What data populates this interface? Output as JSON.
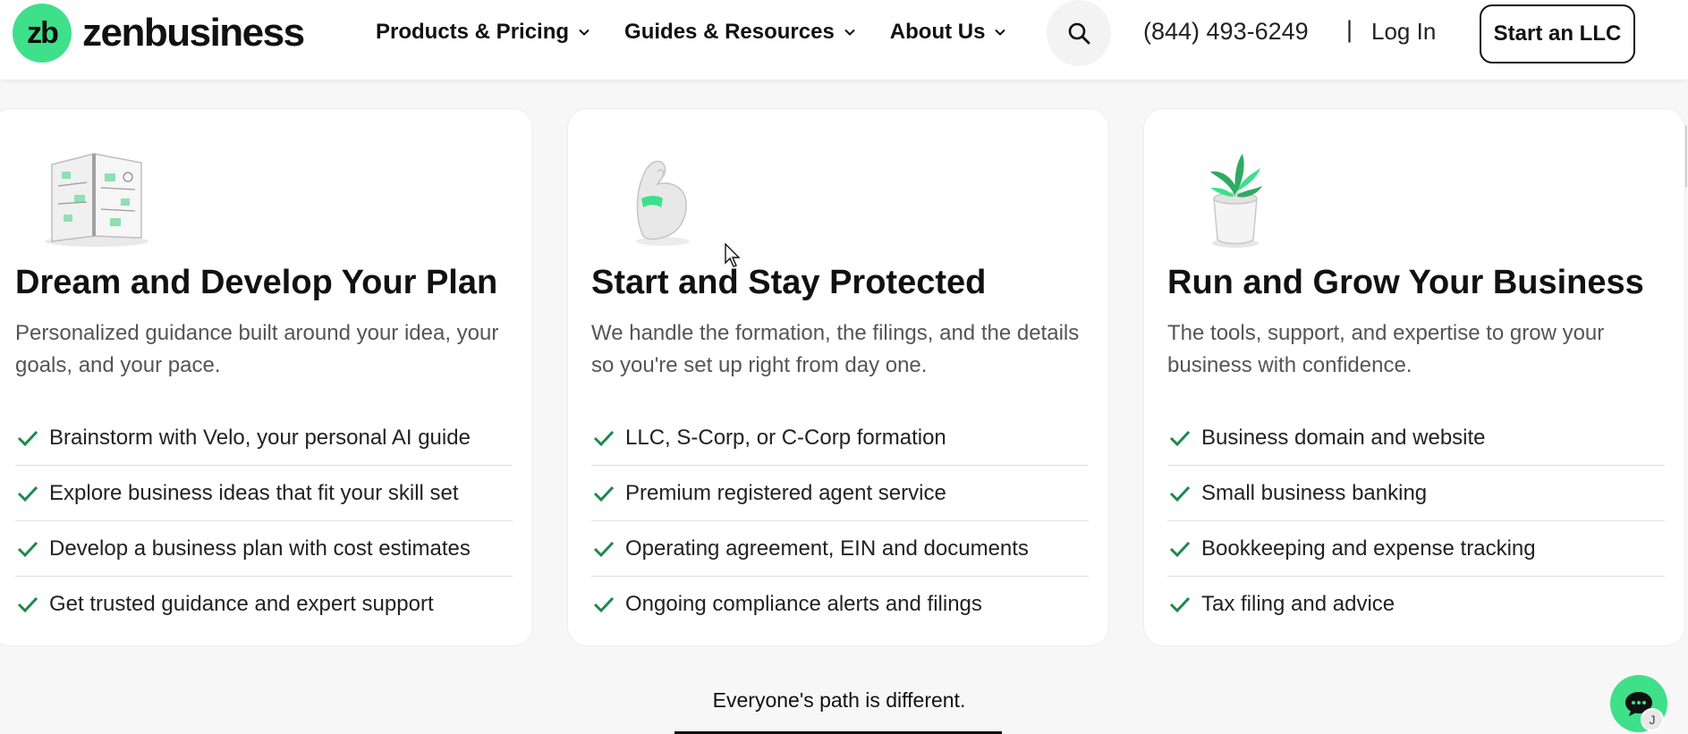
{
  "header": {
    "logo_mark": "zb",
    "logo_word": "zenbusiness",
    "nav": [
      {
        "label": "Products & Pricing"
      },
      {
        "label": "Guides & Resources"
      },
      {
        "label": "About Us"
      }
    ],
    "phone": "(844) 493-6249",
    "separator": "|",
    "login_label": "Log In",
    "cta_label": "Start an LLC"
  },
  "cards": [
    {
      "illustration": "notebook-icon",
      "title": "Dream and Develop Your Plan",
      "description": "Personalized guidance built around your idea, your goals, and your pace.",
      "features": [
        "Brainstorm with Velo, your personal AI guide",
        "Explore business ideas that fit your skill set",
        "Develop a business plan with cost estimates",
        "Get trusted guidance and expert support"
      ]
    },
    {
      "illustration": "flexed-arm-icon",
      "title": "Start and Stay Protected",
      "description": "We handle the formation, the filings, and the details so you're set up right from day one.",
      "features": [
        "LLC, S-Corp, or C-Corp formation",
        "Premium registered agent service",
        "Operating agreement, EIN and documents",
        "Ongoing compliance alerts and filings"
      ]
    },
    {
      "illustration": "potted-plant-icon",
      "title": "Run and Grow Your Business",
      "description": "The tools, support, and expertise to grow your business with confidence.",
      "features": [
        "Business domain and website",
        "Small business banking",
        "Bookkeeping and expense tracking",
        "Tax filing and advice"
      ]
    }
  ],
  "tagline": "Everyone's path is different.",
  "chat": {
    "avatar_initial": "J"
  },
  "colors": {
    "brand_green": "#3ee08a",
    "check_green": "#1a8a4a"
  }
}
